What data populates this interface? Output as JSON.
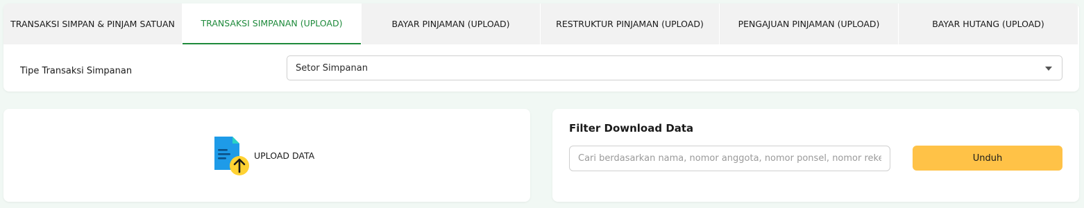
{
  "tabs": [
    {
      "label": "TRANSAKSI SIMPAN & PINJAM SATUAN",
      "active": false
    },
    {
      "label": "TRANSAKSI SIMPANAN (UPLOAD)",
      "active": true
    },
    {
      "label": "BAYAR PINJAMAN (UPLOAD)",
      "active": false
    },
    {
      "label": "RESTRUKTUR PINJAMAN (UPLOAD)",
      "active": false
    },
    {
      "label": "PENGAJUAN PINJAMAN (UPLOAD)",
      "active": false
    },
    {
      "label": "BAYAR HUTANG (UPLOAD)",
      "active": false
    }
  ],
  "form": {
    "tipe_label": "Tipe Transaksi Simpanan",
    "tipe_value": "Setor Simpanan"
  },
  "upload": {
    "label": "UPLOAD DATA",
    "icon": "file-upload-icon"
  },
  "filter": {
    "title": "Filter Download Data",
    "search_placeholder": "Cari berdasarkan nama, nomor anggota, nomor ponsel, nomor rekening",
    "search_value": "",
    "download_label": "Unduh"
  },
  "colors": {
    "accent_green": "#1e8a3b",
    "button_yellow": "#ffc247",
    "icon_blue": "#1e9be8",
    "icon_fold": "#2ad2c4",
    "icon_badge": "#ffd233",
    "page_bg": "#f1f8f4"
  }
}
